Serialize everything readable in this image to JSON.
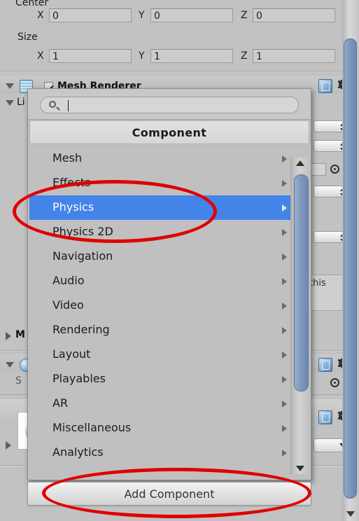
{
  "inspector": {
    "bounds_section": {
      "center_label": "Center",
      "size_label": "Size",
      "axes": [
        "X",
        "Y",
        "Z"
      ],
      "center_values": [
        "0",
        "0",
        "0"
      ],
      "size_values": [
        "1",
        "1",
        "1"
      ]
    },
    "components": [
      {
        "title": "Mesh Renderer",
        "icon": "mesh-renderer-icon",
        "enabled": true,
        "foldout": "open"
      },
      {
        "title": "Li",
        "icon": "lighting-icon",
        "foldout": "open"
      },
      {
        "title": "M",
        "icon": "materials-icon",
        "foldout": "closed"
      },
      {
        "title": "",
        "icon": "component-icon",
        "foldout": "open"
      },
      {
        "title": "S",
        "icon": "shader-icon",
        "foldout": "closed"
      }
    ],
    "help_box_text": "this",
    "icons": {
      "help": "help-icon",
      "gear": "gear-icon",
      "target": "target-picker-icon",
      "foldout_open": "triangle-down-icon",
      "foldout_closed": "triangle-right-icon"
    }
  },
  "menu": {
    "search_placeholder": "",
    "search_value": "",
    "search_icon": "search-icon",
    "title": "Component",
    "items": [
      {
        "label": "Mesh",
        "has_submenu": true,
        "selected": false
      },
      {
        "label": "Effects",
        "has_submenu": true,
        "selected": false
      },
      {
        "label": "Physics",
        "has_submenu": true,
        "selected": true
      },
      {
        "label": "Physics 2D",
        "has_submenu": true,
        "selected": false
      },
      {
        "label": "Navigation",
        "has_submenu": true,
        "selected": false
      },
      {
        "label": "Audio",
        "has_submenu": true,
        "selected": false
      },
      {
        "label": "Video",
        "has_submenu": true,
        "selected": false
      },
      {
        "label": "Rendering",
        "has_submenu": true,
        "selected": false
      },
      {
        "label": "Layout",
        "has_submenu": true,
        "selected": false
      },
      {
        "label": "Playables",
        "has_submenu": true,
        "selected": false
      },
      {
        "label": "AR",
        "has_submenu": true,
        "selected": false
      },
      {
        "label": "Miscellaneous",
        "has_submenu": true,
        "selected": false
      },
      {
        "label": "Analytics",
        "has_submenu": true,
        "selected": false
      }
    ],
    "scrollbar": {
      "up_icon": "scroll-up-arrow-icon",
      "down_icon": "scroll-down-arrow-icon"
    }
  },
  "add_component_button": {
    "label": "Add Component"
  },
  "annotations": [
    {
      "name": "physics-highlight-ellipse",
      "color": "#e00000"
    },
    {
      "name": "add-component-highlight-ellipse",
      "color": "#e00000"
    }
  ],
  "colors": {
    "panel_bg": "#c2c2c2",
    "selection_blue": "#4483e8",
    "annotation_red": "#e00000",
    "scrollbar_blue": "#7d97bd"
  }
}
